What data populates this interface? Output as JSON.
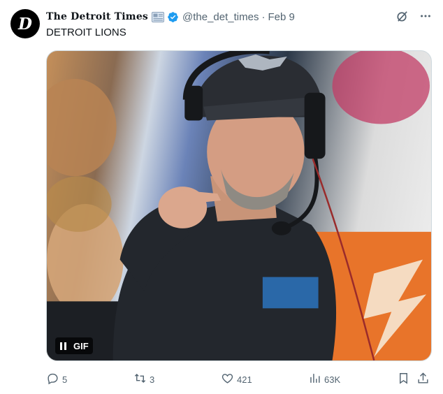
{
  "author": {
    "avatar_letter": "D",
    "display_name": "The Detroit Times",
    "handle": "@the_det_times",
    "separator": "·",
    "date": "Feb 9"
  },
  "tweet": {
    "text": "DETROIT LIONS"
  },
  "media": {
    "badge_label": "GIF",
    "play_state": "paused"
  },
  "actions": {
    "replies": "5",
    "reposts": "3",
    "likes": "421",
    "views": "63K"
  },
  "icons": {
    "avatar": "detroit-times-logo",
    "news": "newspaper-icon",
    "verified": "verified-badge-icon",
    "grok": "grok-icon",
    "more": "more-icon",
    "reply": "reply-icon",
    "repost": "repost-icon",
    "like": "heart-icon",
    "views": "views-icon",
    "bookmark": "bookmark-icon",
    "share": "share-icon"
  },
  "colors": {
    "verified": "#1d9bf0",
    "muted": "#536471",
    "text": "#0f1419"
  }
}
